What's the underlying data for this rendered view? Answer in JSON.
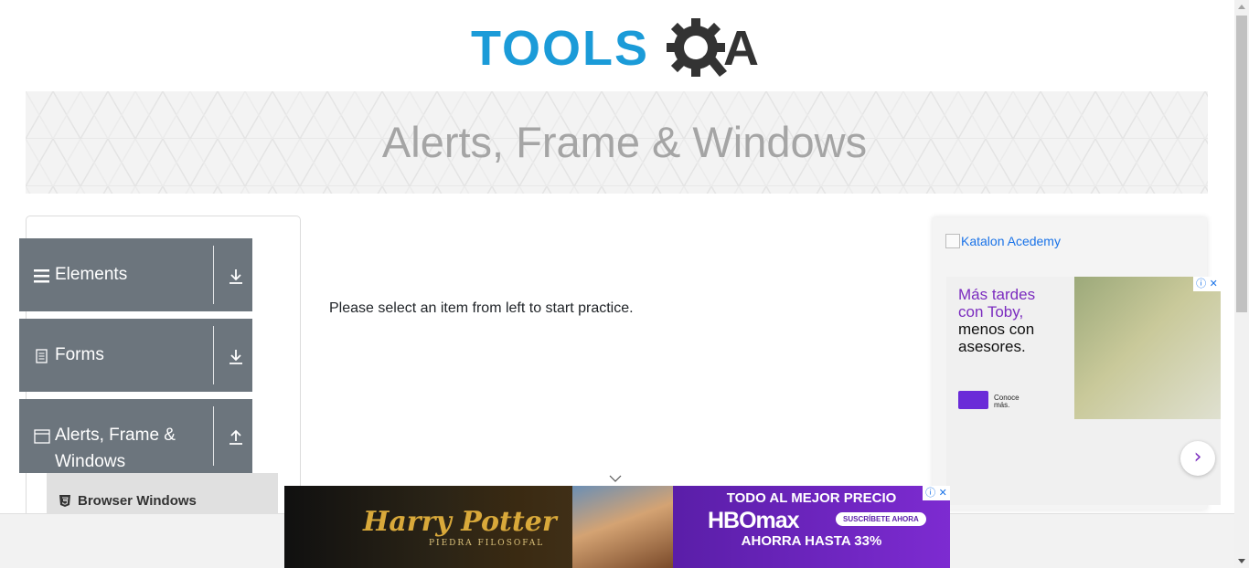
{
  "header": {
    "logo_text": "TOOLS",
    "logo_suffix": "A",
    "brand_color": "#1B9BD8"
  },
  "banner": {
    "title": "Alerts, Frame & Windows"
  },
  "sidebar": {
    "groups": [
      {
        "label": "Elements",
        "icon": "hamburger-icon",
        "state": "collapsed"
      },
      {
        "label": "Forms",
        "icon": "document-icon",
        "state": "collapsed"
      },
      {
        "label": "Alerts, Frame &",
        "label2": "Windows",
        "icon": "window-icon",
        "state": "expanded"
      }
    ],
    "sub_items": [
      {
        "label": "Browser Windows",
        "icon": "html5-icon"
      }
    ],
    "group_color": "#6c757d"
  },
  "main": {
    "message": "Please select an item from left to start practice."
  },
  "right_ad": {
    "image_alt": "Katalon Acedemy",
    "line1": "Más tardes",
    "line2": "con Toby,",
    "line3": "menos con",
    "line4": "asesores.",
    "small": "Conoce",
    "small2": "más.",
    "next_icon": "chevron-right-icon",
    "close_label": "ⓘ ✕",
    "accent": "#7b2cbf"
  },
  "bottom_ad": {
    "hp_title": "Harry Potter",
    "hp_sub": "PIEDRA FILOSOFAL",
    "line1": "TODO AL MEJOR PRECIO",
    "logo": "HBOmax",
    "cta": "SUSCRÍBETE AHORA",
    "line3": "AHORRA HASTA 33%",
    "close_label": "ⓘ ✕"
  }
}
